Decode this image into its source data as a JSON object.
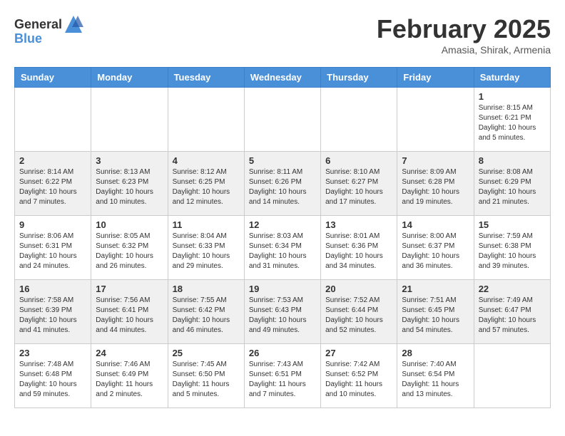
{
  "header": {
    "logo_general": "General",
    "logo_blue": "Blue",
    "month": "February 2025",
    "location": "Amasia, Shirak, Armenia"
  },
  "weekdays": [
    "Sunday",
    "Monday",
    "Tuesday",
    "Wednesday",
    "Thursday",
    "Friday",
    "Saturday"
  ],
  "weeks": [
    [
      {
        "day": "",
        "info": ""
      },
      {
        "day": "",
        "info": ""
      },
      {
        "day": "",
        "info": ""
      },
      {
        "day": "",
        "info": ""
      },
      {
        "day": "",
        "info": ""
      },
      {
        "day": "",
        "info": ""
      },
      {
        "day": "1",
        "info": "Sunrise: 8:15 AM\nSunset: 6:21 PM\nDaylight: 10 hours\nand 5 minutes."
      }
    ],
    [
      {
        "day": "2",
        "info": "Sunrise: 8:14 AM\nSunset: 6:22 PM\nDaylight: 10 hours\nand 7 minutes."
      },
      {
        "day": "3",
        "info": "Sunrise: 8:13 AM\nSunset: 6:23 PM\nDaylight: 10 hours\nand 10 minutes."
      },
      {
        "day": "4",
        "info": "Sunrise: 8:12 AM\nSunset: 6:25 PM\nDaylight: 10 hours\nand 12 minutes."
      },
      {
        "day": "5",
        "info": "Sunrise: 8:11 AM\nSunset: 6:26 PM\nDaylight: 10 hours\nand 14 minutes."
      },
      {
        "day": "6",
        "info": "Sunrise: 8:10 AM\nSunset: 6:27 PM\nDaylight: 10 hours\nand 17 minutes."
      },
      {
        "day": "7",
        "info": "Sunrise: 8:09 AM\nSunset: 6:28 PM\nDaylight: 10 hours\nand 19 minutes."
      },
      {
        "day": "8",
        "info": "Sunrise: 8:08 AM\nSunset: 6:29 PM\nDaylight: 10 hours\nand 21 minutes."
      }
    ],
    [
      {
        "day": "9",
        "info": "Sunrise: 8:06 AM\nSunset: 6:31 PM\nDaylight: 10 hours\nand 24 minutes."
      },
      {
        "day": "10",
        "info": "Sunrise: 8:05 AM\nSunset: 6:32 PM\nDaylight: 10 hours\nand 26 minutes."
      },
      {
        "day": "11",
        "info": "Sunrise: 8:04 AM\nSunset: 6:33 PM\nDaylight: 10 hours\nand 29 minutes."
      },
      {
        "day": "12",
        "info": "Sunrise: 8:03 AM\nSunset: 6:34 PM\nDaylight: 10 hours\nand 31 minutes."
      },
      {
        "day": "13",
        "info": "Sunrise: 8:01 AM\nSunset: 6:36 PM\nDaylight: 10 hours\nand 34 minutes."
      },
      {
        "day": "14",
        "info": "Sunrise: 8:00 AM\nSunset: 6:37 PM\nDaylight: 10 hours\nand 36 minutes."
      },
      {
        "day": "15",
        "info": "Sunrise: 7:59 AM\nSunset: 6:38 PM\nDaylight: 10 hours\nand 39 minutes."
      }
    ],
    [
      {
        "day": "16",
        "info": "Sunrise: 7:58 AM\nSunset: 6:39 PM\nDaylight: 10 hours\nand 41 minutes."
      },
      {
        "day": "17",
        "info": "Sunrise: 7:56 AM\nSunset: 6:41 PM\nDaylight: 10 hours\nand 44 minutes."
      },
      {
        "day": "18",
        "info": "Sunrise: 7:55 AM\nSunset: 6:42 PM\nDaylight: 10 hours\nand 46 minutes."
      },
      {
        "day": "19",
        "info": "Sunrise: 7:53 AM\nSunset: 6:43 PM\nDaylight: 10 hours\nand 49 minutes."
      },
      {
        "day": "20",
        "info": "Sunrise: 7:52 AM\nSunset: 6:44 PM\nDaylight: 10 hours\nand 52 minutes."
      },
      {
        "day": "21",
        "info": "Sunrise: 7:51 AM\nSunset: 6:45 PM\nDaylight: 10 hours\nand 54 minutes."
      },
      {
        "day": "22",
        "info": "Sunrise: 7:49 AM\nSunset: 6:47 PM\nDaylight: 10 hours\nand 57 minutes."
      }
    ],
    [
      {
        "day": "23",
        "info": "Sunrise: 7:48 AM\nSunset: 6:48 PM\nDaylight: 10 hours\nand 59 minutes."
      },
      {
        "day": "24",
        "info": "Sunrise: 7:46 AM\nSunset: 6:49 PM\nDaylight: 11 hours\nand 2 minutes."
      },
      {
        "day": "25",
        "info": "Sunrise: 7:45 AM\nSunset: 6:50 PM\nDaylight: 11 hours\nand 5 minutes."
      },
      {
        "day": "26",
        "info": "Sunrise: 7:43 AM\nSunset: 6:51 PM\nDaylight: 11 hours\nand 7 minutes."
      },
      {
        "day": "27",
        "info": "Sunrise: 7:42 AM\nSunset: 6:52 PM\nDaylight: 11 hours\nand 10 minutes."
      },
      {
        "day": "28",
        "info": "Sunrise: 7:40 AM\nSunset: 6:54 PM\nDaylight: 11 hours\nand 13 minutes."
      },
      {
        "day": "",
        "info": ""
      }
    ]
  ]
}
